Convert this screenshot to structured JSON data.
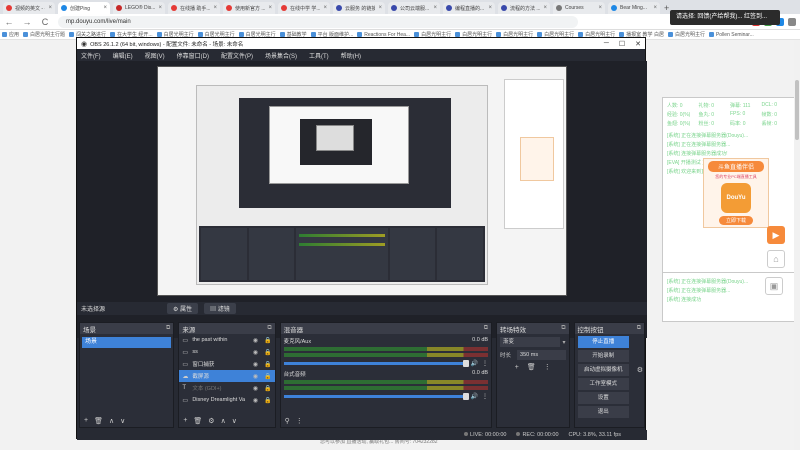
{
  "browser": {
    "tabs": [
      {
        "label": "视频的英文 - 谷歌",
        "color": "#e53935",
        "active": false
      },
      {
        "label": "创建Ping",
        "color": "#1e88e5",
        "active": true
      },
      {
        "label": "LEGO® Dis...",
        "color": "#c62828",
        "active": false
      },
      {
        "label": "在线播 助手...",
        "color": "#e53935",
        "active": false
      },
      {
        "label": "使用新官方 ...",
        "color": "#e53935",
        "active": false
      },
      {
        "label": "在线中学 学...",
        "color": "#e53935",
        "active": false
      },
      {
        "label": "云服务 的链接",
        "color": "#3949ab",
        "active": false
      },
      {
        "label": "公司云端服...",
        "color": "#3949ab",
        "active": false
      },
      {
        "label": "编程直播的...",
        "color": "#3949ab",
        "active": false
      },
      {
        "label": "流程的方法 ...",
        "color": "#3949ab",
        "active": false
      },
      {
        "label": "Courses",
        "color": "#777777",
        "active": false
      },
      {
        "label": "Bear Ming...",
        "color": "#1e88e5",
        "active": false
      }
    ],
    "new_tab": "+",
    "nav": {
      "back": "←",
      "forward": "→",
      "reload": "C"
    },
    "url": "mp.douyu.com/live/main",
    "bookmarks": [
      "应用",
      "白居光明主行题",
      "闯关之路进行",
      "在大学生 经开...",
      "白居光明主行",
      "白居光明主行",
      "白居光明主行",
      "基础教学",
      "平台 版面维护...",
      "Reactions For Hea...",
      "白居光明主行",
      "白居光明主行",
      "白居光明主行",
      "白居光明主行",
      "白居光明主行",
      "播报室 教学 白居",
      "白居光明主行",
      "Pollen Seminar..."
    ],
    "toast": "请选择: 回馈(产给帮我)... 红签到..."
  },
  "side_panel": {
    "stats": [
      "人数: 0",
      "礼物: 0",
      "弹幕: 111",
      "DCL: 0",
      "经验: 0(%)",
      "鱼丸: 0",
      "FPS: 0",
      "帧数: 0",
      "鱼翅: 0(%)",
      "粉丝: 0",
      "码率: 0",
      "丢帧: 0"
    ],
    "messages": [
      "[系统] 正在连接弹幕服务器(Douyu)...",
      "[系统] 正在连接弹幕服务器...",
      "[系统] 连接弹幕服务器成功!",
      "[EVA] 开播测试 正在获取中...",
      "[系统] 欢迎来到直播间"
    ],
    "promo": {
      "title": "斗鱼直播伴侣",
      "subtitle": "您的专业PC端直播工具",
      "icon_text": "DouYu",
      "button": "立即下载"
    },
    "bottom_messages": [
      "[系统] 正在连接弹幕服务器(Douyu)...",
      "[系统] 正在连接弹幕服务器...",
      "[系统] 连接成功"
    ]
  },
  "page_footer": "您可以参加 直播活动, 赢取礼包... 房间号: 704232282",
  "obs": {
    "title": "OBS 26.1.2 (64 bit, windows) - 配置文件: 未命名 - 场景: 未命名",
    "menu": [
      "文件(F)",
      "编辑(E)",
      "视图(V)",
      "停靠窗口(D)",
      "配置文件(P)",
      "场景集合(S)",
      "工具(T)",
      "帮助(H)"
    ],
    "scene_bar": {
      "label": "未选择源",
      "properties": "属性",
      "filters": "滤镜"
    },
    "scenes": {
      "title": "场景",
      "items": [
        "场景"
      ]
    },
    "sources": {
      "title": "来源",
      "items": [
        {
          "name": "the past within",
          "icon": "▭",
          "selected": false,
          "dim": false
        },
        {
          "name": "ss",
          "icon": "▭",
          "selected": false,
          "dim": false
        },
        {
          "name": "窗口捕获",
          "icon": "▭",
          "selected": false,
          "dim": false
        },
        {
          "name": "截屏源",
          "icon": "☁",
          "selected": true,
          "dim": false
        },
        {
          "name": "文本 (GDI+)",
          "icon": "T",
          "selected": false,
          "dim": true
        },
        {
          "name": "Disney Dreamlight Va",
          "icon": "▭",
          "selected": false,
          "dim": false
        }
      ]
    },
    "mixer": {
      "title": "混音器",
      "channels": [
        {
          "name": "麦克风/Aux",
          "db": "0.0 dB"
        },
        {
          "name": "台式音频",
          "db": "0.0 dB"
        }
      ]
    },
    "transitions": {
      "title": "转场特效",
      "selected": "渐变",
      "duration_label": "时长",
      "duration": "350 ms"
    },
    "controls": {
      "title": "控制按钮",
      "buttons": [
        "停止直播",
        "开始录制",
        "启动虚拟摄像机",
        "工作室模式",
        "设置",
        "退出"
      ]
    },
    "status": {
      "live": "LIVE: 00:00:00",
      "rec": "REC: 00:00:00",
      "cpu": "CPU: 3.8%, 33.11 fps"
    }
  }
}
